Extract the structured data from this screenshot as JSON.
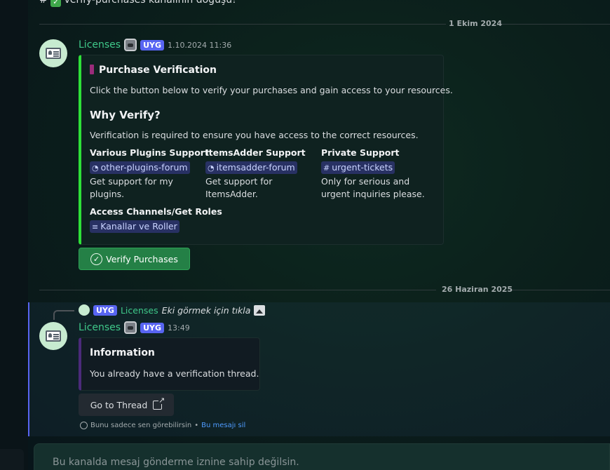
{
  "top_message": {
    "prefix": "#",
    "check": "✓",
    "text": "verify-purchases kanalının doğuşu!"
  },
  "dividers": {
    "first": "1 Ekim 2024",
    "second": "26 Haziran 2025"
  },
  "message1": {
    "username": "Licenses",
    "tag": "UYG",
    "timestamp": "1.10.2024 11:36",
    "embed": {
      "title": "Purchase Verification",
      "description": "Click the button below to verify your purchases and gain access to your resources.",
      "section_title": "Why Verify?",
      "section_text": "Verification is required to ensure you have access to the correct resources.",
      "fields": [
        {
          "name": "Various Plugins Support",
          "channel": "other-plugins-forum",
          "value_line1": "Get support for my",
          "value_line2": "plugins."
        },
        {
          "name": "ItemsAdder Support",
          "channel": "itemsadder-forum",
          "value_line1": "Get support for",
          "value_line2": "ItemsAdder."
        },
        {
          "name": "Private Support",
          "channel": "urgent-tickets",
          "value_line1": "Only for serious and",
          "value_line2": "urgent inquiries please."
        }
      ],
      "access_title": "Access Channels/Get Roles",
      "access_channel": "Kanallar ve Roller"
    },
    "button": "Verify Purchases",
    "button_icon": "✓"
  },
  "message2": {
    "reply": {
      "tag": "UYG",
      "username": "Licenses",
      "text": "Eki görmek için tıkla"
    },
    "username": "Licenses",
    "tag": "UYG",
    "timestamp": "13:49",
    "embed": {
      "title": "Information",
      "description": "You already have a verification thread."
    },
    "button": "Go to Thread",
    "ephemeral_text": "Bunu sadece sen görebilirsin",
    "ephemeral_sep": " • ",
    "ephemeral_link": "Bu mesajı sil"
  },
  "composer": {
    "placeholder": "Bu kanalda mesaj gönderme iznine sahip değilsin."
  },
  "colors": {
    "accent_green": "#2ee038",
    "username_green": "#3fc98a",
    "tag_blurple": "#5865f2",
    "button_green": "#248046"
  }
}
